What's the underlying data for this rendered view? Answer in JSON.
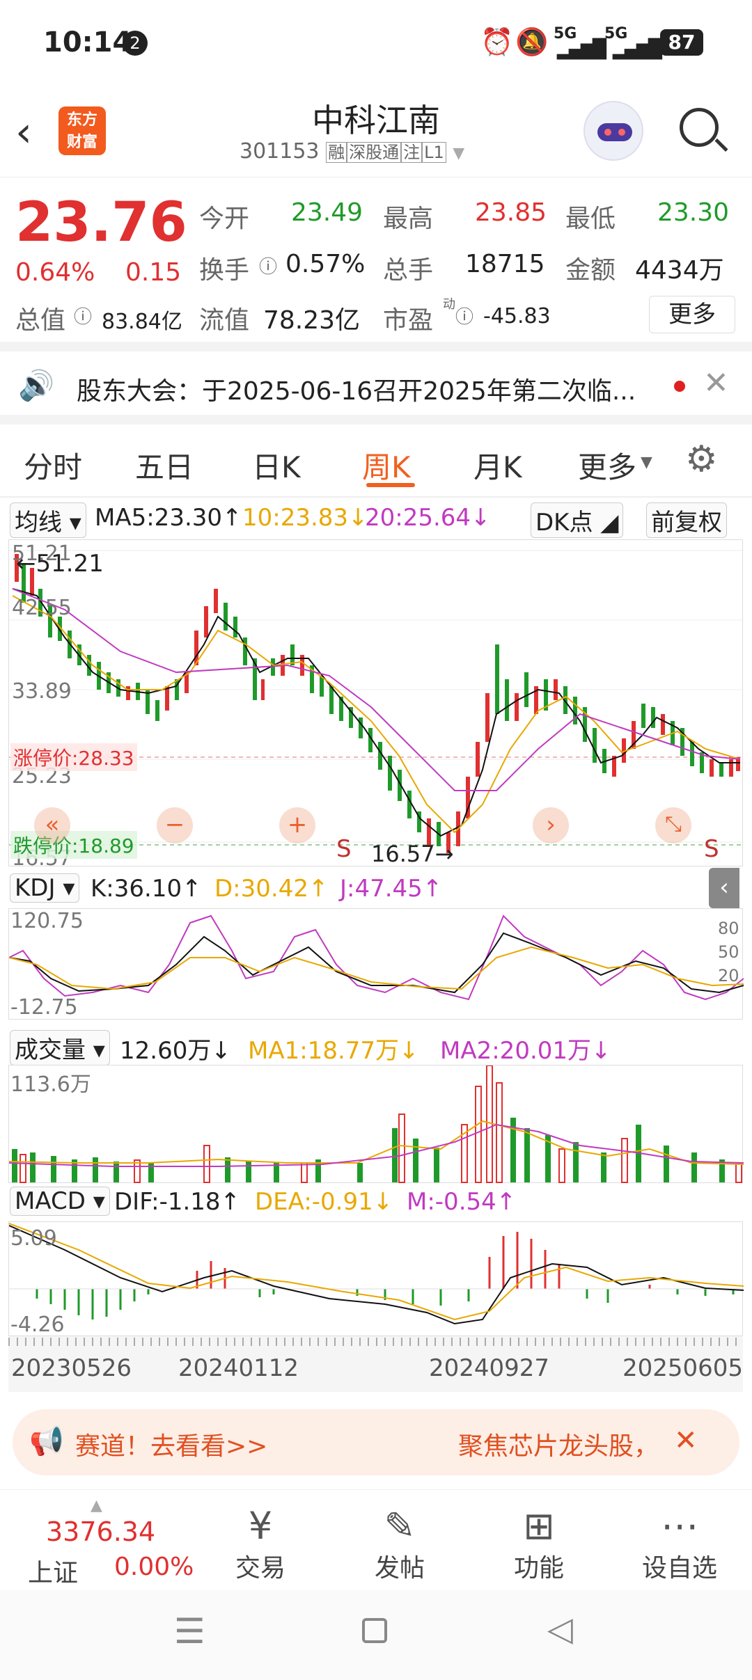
{
  "status": {
    "time": "10:14",
    "notif_count": "2",
    "signal1": "5G",
    "signal2": "5G",
    "battery": "87"
  },
  "header": {
    "title": "中科江南",
    "code": "301153",
    "tags": [
      "融",
      "深股通",
      "注",
      "L1"
    ],
    "logo_line1": "东方",
    "logo_line2": "财富"
  },
  "quote": {
    "price": "23.76",
    "change_pct": "0.64%",
    "change": "0.15",
    "open_label": "今开",
    "open": "23.49",
    "high_label": "最高",
    "high": "23.85",
    "low_label": "最低",
    "low": "23.30",
    "turnover_label": "换手",
    "turnover": "0.57%",
    "volume_label": "总手",
    "volume": "18715",
    "amount_label": "金额",
    "amount": "4434万",
    "mktcap_label": "总值",
    "mktcap": "83.84亿",
    "float_label": "流值",
    "float": "78.23亿",
    "pe_label": "市盈",
    "pe_sup": "动",
    "pe": "-45.83",
    "more": "更多"
  },
  "notice": {
    "text": "股东大会：于2025-06-16召开2025年第二次临..."
  },
  "tabs": [
    "分时",
    "五日",
    "日K",
    "周K",
    "月K",
    "更多"
  ],
  "active_tab": "周K",
  "ma": {
    "selector": "均线",
    "ma5": "MA5:23.30↑",
    "ma10": "10:23.83↓",
    "ma20": "20:25.64↓",
    "dk": "DK点",
    "adjust": "前复权"
  },
  "kline": {
    "y_labels": [
      "51.21",
      "42.55",
      "33.89",
      "25.23",
      "16.57"
    ],
    "max_marker": "←51.21",
    "min_marker": "16.57→",
    "limit_up": "涨停价:28.33",
    "limit_down": "跌停价:18.89",
    "signal_s": "S"
  },
  "kdj": {
    "selector": "KDJ",
    "k": "K:36.10↑",
    "d": "D:30.42↑",
    "j": "J:47.45↑",
    "y_top": "120.75",
    "y_bottom": "-12.75",
    "levels": [
      "80",
      "50",
      "20"
    ]
  },
  "vol": {
    "selector": "成交量",
    "value": "12.60万↓",
    "ma1": "MA1:18.77万↓",
    "ma2": "MA2:20.01万↓",
    "y_top": "113.6万"
  },
  "macd": {
    "selector": "MACD",
    "dif": "DIF:-1.18↑",
    "dea": "DEA:-0.91↓",
    "m": "M:-0.54↑",
    "y_top": "5.09",
    "y_bottom": "-4.26"
  },
  "dates": [
    "20230526",
    "20240112",
    "20240927",
    "20250605"
  ],
  "banner": {
    "text_left": "赛道！去看看>>",
    "text_right": "聚焦芯片龙头股，"
  },
  "bottom": {
    "index_value": "3376.34",
    "index_name": "上证",
    "index_change": "0.00%",
    "items": [
      "交易",
      "发帖",
      "功能",
      "设自选"
    ]
  },
  "colors": {
    "up": "#e03030",
    "down": "#1f9a2a",
    "accent": "#f06020",
    "ma10": "#e8a800",
    "ma20": "#c03ac0"
  }
}
